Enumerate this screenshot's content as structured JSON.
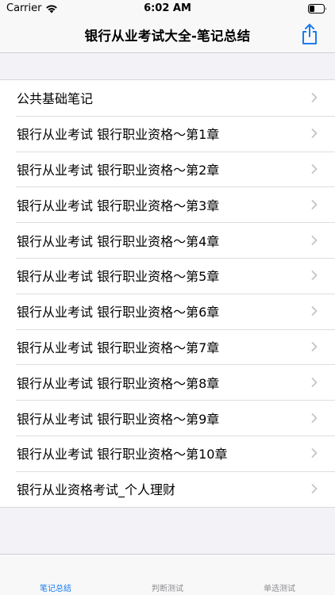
{
  "status_bar": {
    "carrier": "Carrier",
    "time": "6:02 AM"
  },
  "nav": {
    "title": "银行从业考试大全-笔记总结",
    "share_icon": "share-icon"
  },
  "list": {
    "items": [
      {
        "label": "公共基础笔记"
      },
      {
        "label": "银行从业考试 银行职业资格～第1章"
      },
      {
        "label": "银行从业考试 银行职业资格～第2章"
      },
      {
        "label": "银行从业考试 银行职业资格～第3章"
      },
      {
        "label": "银行从业考试 银行职业资格～第4章"
      },
      {
        "label": "银行从业考试 银行职业资格～第5章"
      },
      {
        "label": "银行从业考试 银行职业资格～第6章"
      },
      {
        "label": "银行从业考试 银行职业资格～第7章"
      },
      {
        "label": "银行从业考试 银行职业资格～第8章"
      },
      {
        "label": "银行从业考试 银行职业资格～第9章"
      },
      {
        "label": "银行从业考试 银行职业资格～第10章"
      },
      {
        "label": "银行从业资格考试_个人理财"
      }
    ]
  },
  "tab_bar": {
    "tabs": [
      {
        "label": "笔记总结",
        "active": true
      },
      {
        "label": "判断测试",
        "active": false
      },
      {
        "label": "单选测试",
        "active": false
      }
    ]
  },
  "colors": {
    "accent": "#1a7cf0",
    "background": "#f2f2f7",
    "chevron": "#c4c4c7"
  }
}
